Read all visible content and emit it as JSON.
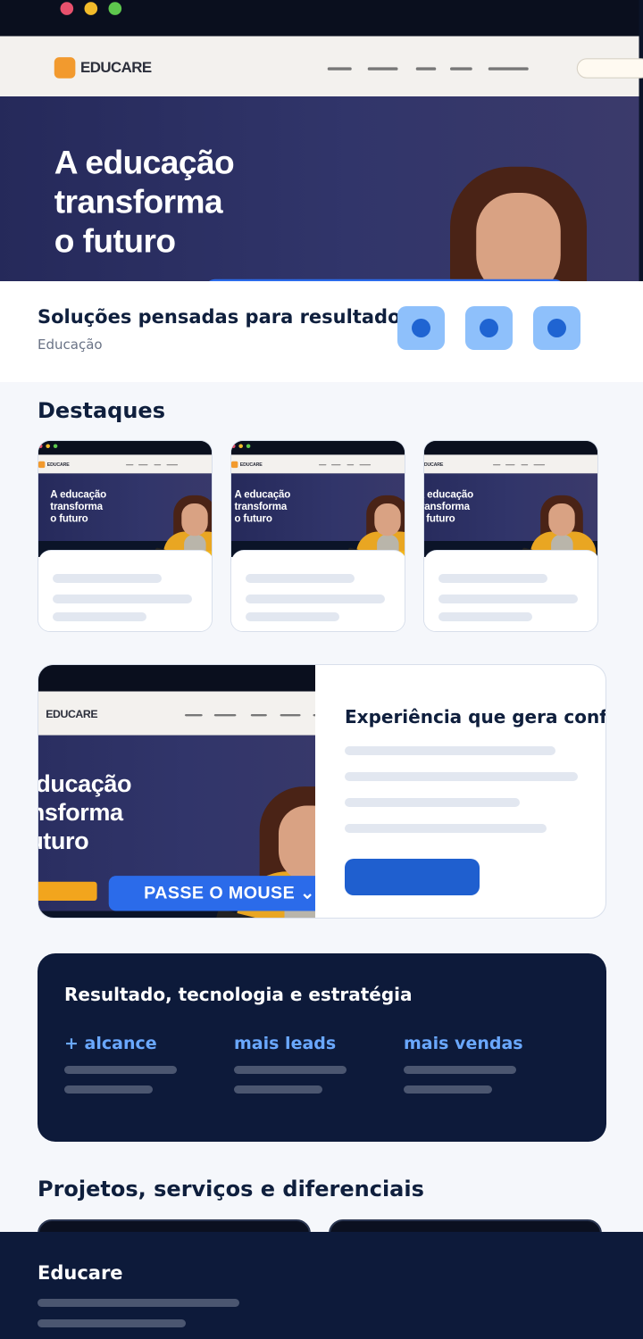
{
  "hero_screenshot": {
    "brand": "EDUCARE",
    "headline_line1": "A educação",
    "headline_line2": "transforma",
    "headline_line3": "o futuro",
    "hover_button": "PASSE O MOUSE ⌄"
  },
  "intro": {
    "title": "Soluções pensadas para resultados",
    "subtitle": "Educação"
  },
  "highlights": {
    "title": "Destaques"
  },
  "experience": {
    "title": "Experiência que gera confiança"
  },
  "results": {
    "title": "Resultado, tecnologia e estratégia",
    "stats": [
      "+ alcance",
      "mais leads",
      "mais vendas"
    ]
  },
  "projects": {
    "title": "Projetos, serviços e diferenciais"
  },
  "footer": {
    "brand": "Educare"
  },
  "colors": {
    "accent": "#1f64d2",
    "dark_panel": "#0d1a3a",
    "stat_text": "#6aa8ff"
  }
}
